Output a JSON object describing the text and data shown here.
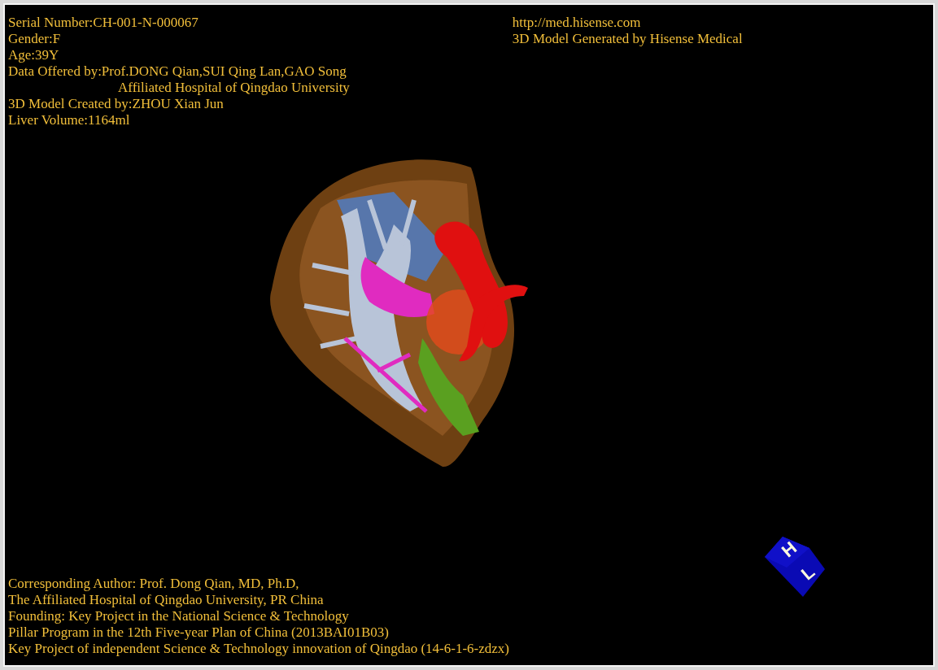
{
  "info_top_left": [
    {
      "text": "Serial Number:CH-001-N-000067",
      "kind": "line"
    },
    {
      "text": "Gender:F",
      "kind": "line"
    },
    {
      "text": "Age:39Y",
      "kind": "line"
    },
    {
      "text": "Data Offered by:Prof.DONG Qian,SUI Qing Lan,GAO Song",
      "kind": "line"
    },
    {
      "text": "Affiliated Hospital of Qingdao University",
      "kind": "continuation"
    },
    {
      "text": "3D Model Created by:ZHOU Xian Jun",
      "kind": "line"
    },
    {
      "text": "Liver Volume:1164ml",
      "kind": "line"
    }
  ],
  "info_top_right": [
    "http://med.hisense.com",
    "3D Model Generated by Hisense Medical"
  ],
  "credits": [
    "Corresponding Author: Prof. Dong Qian, MD, Ph.D,",
    "The Affiliated Hospital of Qingdao University, PR China",
    "Founding: Key Project in the National Science & Technology",
    "Pillar Program in the 12th Five-year Plan of China (2013BAI01B03)",
    "Key Project of independent Science & Technology innovation of Qingdao (14-6-1-6-zdzx)"
  ],
  "orientation_cube": {
    "labels": [
      "H",
      "L"
    ]
  }
}
